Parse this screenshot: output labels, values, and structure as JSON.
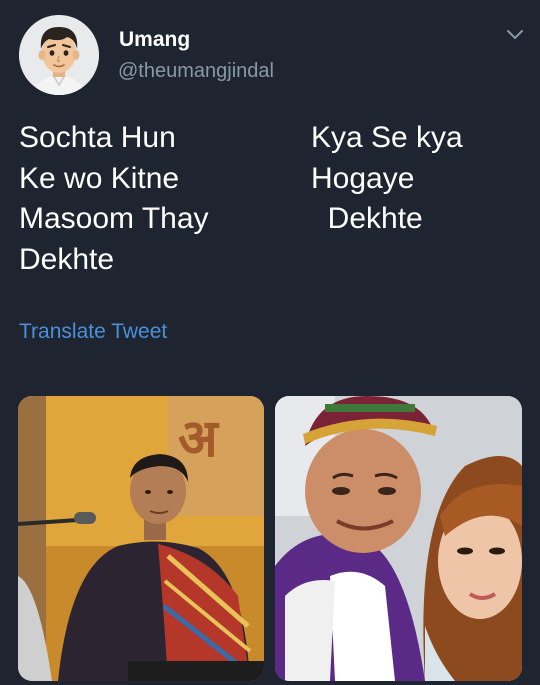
{
  "author": {
    "name": "Umang",
    "handle": "@theumangjindal",
    "avatar": "cartoon-boy-avatar"
  },
  "tweet": {
    "left_column": "Sochta Hun\nKe wo Kitne\nMasoom Thay\nDekhte",
    "right_column": "Kya Se kya\nHogaye\n  Dekhte"
  },
  "translate_label": "Translate Tweet",
  "media": [
    {
      "name": "photo-singer-stage",
      "sign_text": "अ"
    },
    {
      "name": "photo-selfie-couple"
    }
  ],
  "colors": {
    "background": "#1e2430",
    "text": "#ffffff",
    "handle": "#8899a6",
    "link": "#4a90d9"
  },
  "icons": [
    "chevron-down-icon"
  ]
}
